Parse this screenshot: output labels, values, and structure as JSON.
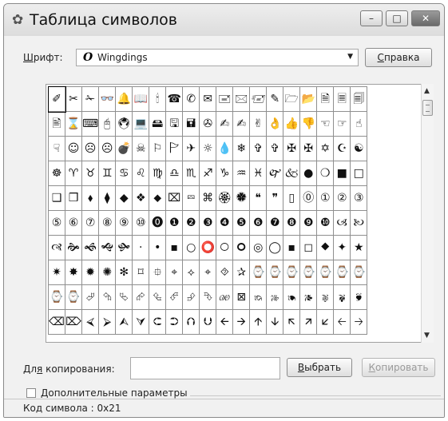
{
  "window": {
    "title": "Таблица символов",
    "app_icon": "character-map-icon",
    "controls": {
      "minimize": "–",
      "maximize": "□",
      "close": "✕"
    }
  },
  "font_row": {
    "label_u": "Ш",
    "label_rest": "рифт:",
    "selected_font_glyph": "O",
    "selected_font": "Wingdings",
    "help_button_u": "С",
    "help_button_rest": "правка"
  },
  "glyph_grid": {
    "rows": [
      [
        "✐",
        "✂",
        "✁",
        "👓",
        "🔔",
        "📖",
        "🕯",
        "☎",
        "✆",
        "✉",
        "🖃",
        "🖂",
        "🖅",
        "✎",
        "🗁",
        "📂",
        "🗎",
        "🗏",
        "🗐"
      ],
      [
        "🖹",
        "⌛",
        "⌨",
        "🖰",
        "🖲",
        "💻",
        "🖴",
        "🖫",
        "🖬",
        "✇",
        "✍",
        "✍",
        "✌",
        "👌",
        "👍",
        "👎",
        "☜",
        "☞",
        "☝"
      ],
      [
        "☟",
        "☺",
        "☹",
        "☹",
        "💣",
        "☠",
        "⚐",
        "🏱",
        "✈",
        "☼",
        "💧",
        "❄",
        "✞",
        "✞",
        "✠",
        "✠",
        "✡",
        "☪",
        "☯"
      ],
      [
        "☸",
        "♈",
        "♉",
        "♊",
        "♋",
        "♌",
        "♍",
        "♎",
        "♏",
        "♐",
        "♑",
        "♒",
        "♓",
        "🙰",
        "🙵",
        "●",
        "❍",
        "■",
        "□"
      ],
      [
        "❑",
        "❒",
        "⬧",
        "⧫",
        "◆",
        "❖",
        "⬥",
        "⌧",
        "⮹",
        "⌘",
        "🏵",
        "🏶",
        "❝",
        "❞",
        "▯",
        "⓪",
        "①",
        "②",
        "③"
      ],
      [
        "⑤",
        "⑥",
        "⑦",
        "⑧",
        "⑨",
        "⑩",
        "⓿",
        "❶",
        "❷",
        "❸",
        "❹",
        "❺",
        "❻",
        "❼",
        "❽",
        "❾",
        "❿",
        "🙢",
        "🙠"
      ],
      [
        "🙣",
        "🙞",
        "🙜",
        "🙝",
        "🙟",
        "·",
        "•",
        "▪",
        "○",
        "⭕",
        "🞅",
        "🞇",
        "◎",
        "◯",
        "▪",
        "◻",
        "⯁",
        "✦",
        "★"
      ],
      [
        "✷",
        "✸",
        "✹",
        "✺",
        "✻",
        "⌑",
        "⯐",
        "⌖",
        "⟡",
        "⌖",
        "⯑",
        "✰",
        "⌚",
        "⌚",
        "⌚",
        "⌚",
        "⌚",
        "⌚",
        "⌚"
      ],
      [
        "⌚",
        "⌚",
        "⮰",
        "⮲",
        "⮱",
        "⮳",
        "⮴",
        "⮶",
        "⮵",
        "⮷",
        "🙐",
        "⊠",
        "🙒",
        "🙓",
        "🙔",
        "🙕",
        "🙖",
        "🙗",
        "🙘"
      ],
      [
        "⌫",
        "⌦",
        "⮘",
        "⮚",
        "⮙",
        "⮛",
        "⮈",
        "⮊",
        "⮉",
        "⮋",
        "🡨",
        "🡪",
        "🡩",
        "🡫",
        "🡬",
        "🡭",
        "🡯",
        "🡠",
        "🡢"
      ]
    ]
  },
  "copy_row": {
    "label_pre": "Дл",
    "label_u": "я",
    "label_post": " копирования:",
    "value": "",
    "select_button_u": "В",
    "select_button_rest": "ыбрать",
    "copy_button_u": "К",
    "copy_button_rest": "опировать"
  },
  "advanced": {
    "label_u": "Д",
    "label_rest": "ополнительные параметры",
    "checked": false
  },
  "status": {
    "text": "Код символа : 0x21"
  }
}
